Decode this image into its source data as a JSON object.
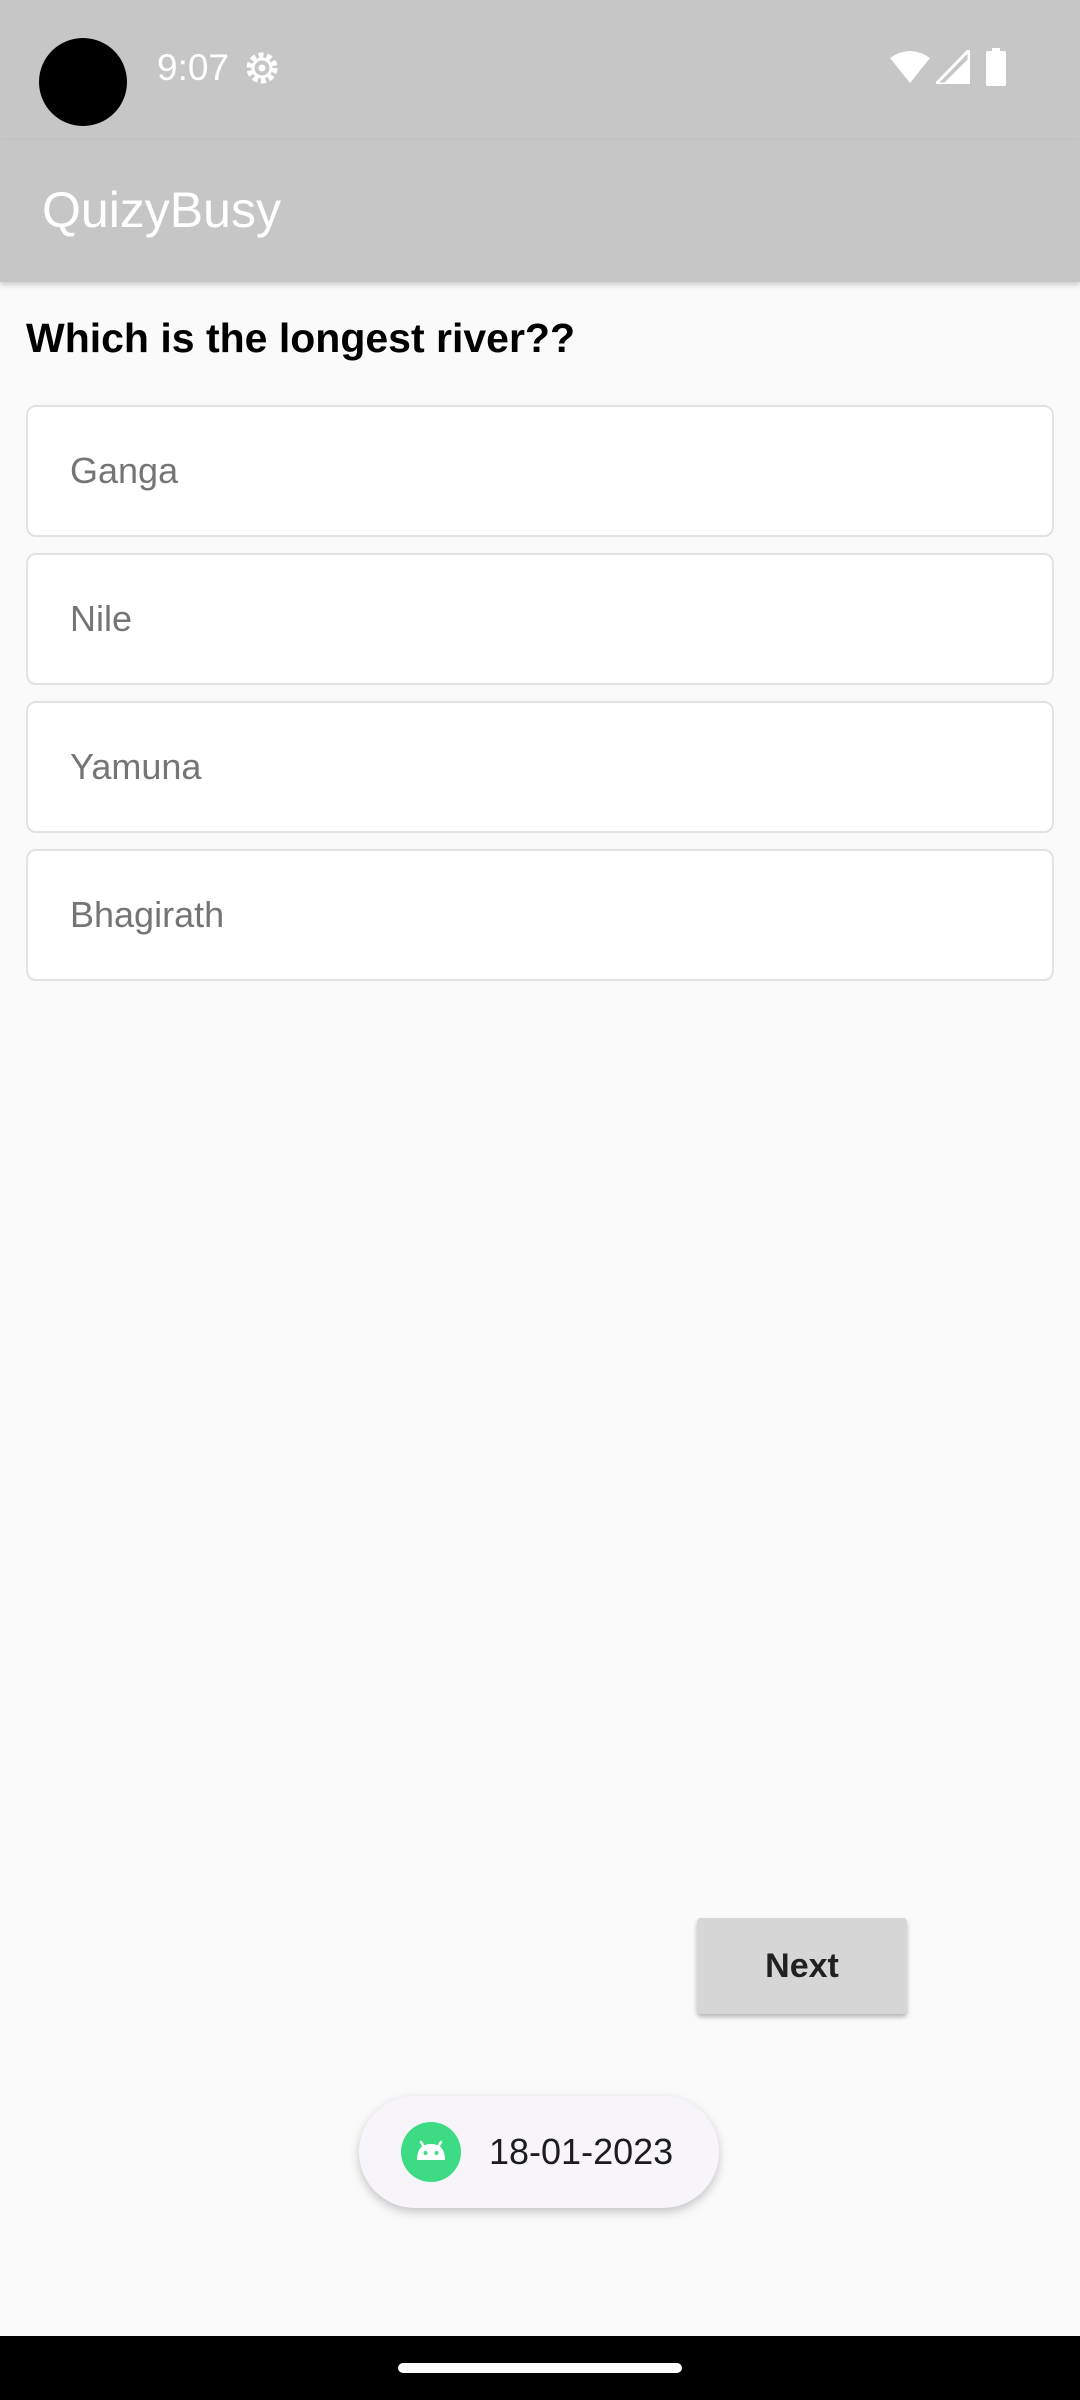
{
  "status_bar": {
    "time": "9:07",
    "icons": [
      "settings-icon",
      "wifi-icon",
      "signal-icon",
      "battery-icon"
    ]
  },
  "app_bar": {
    "title": "QuizyBusy",
    "background_color": "#c6c6c6"
  },
  "quiz": {
    "question": "Which is the longest river??",
    "options": [
      {
        "label": "Ganga"
      },
      {
        "label": "Nile"
      },
      {
        "label": "Yamuna"
      },
      {
        "label": "Bhagirath"
      }
    ],
    "next_label": "Next"
  },
  "toast": {
    "icon": "android-icon",
    "text": "18-01-2023",
    "icon_color": "#3ddc84"
  }
}
